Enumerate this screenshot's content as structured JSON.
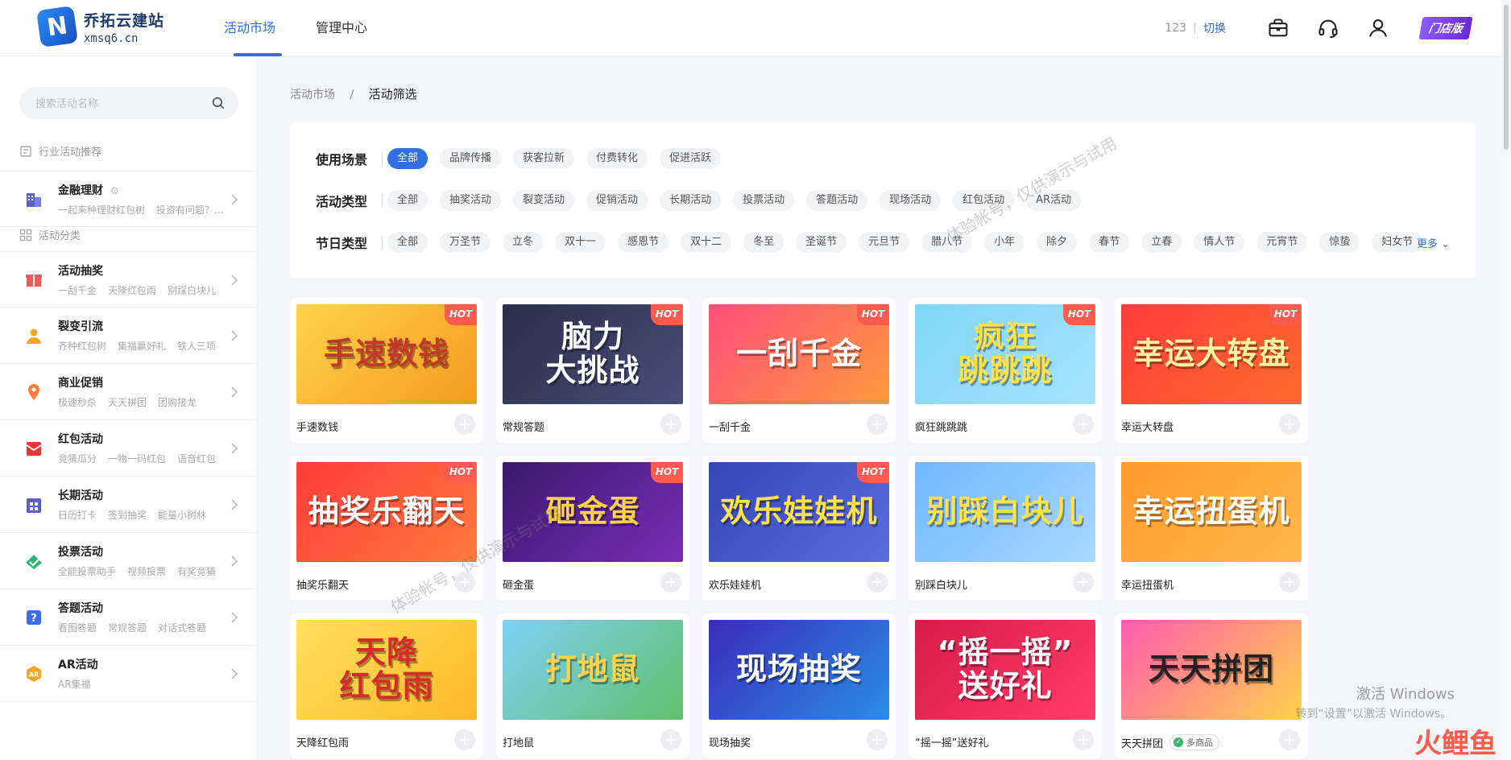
{
  "header": {
    "logo_glyph": "N",
    "site_name": "乔拓云建站",
    "site_domain": "xmsq6.cn",
    "nav": [
      {
        "label": "活动市场",
        "active": true
      },
      {
        "label": "管理中心",
        "active": false
      }
    ],
    "account_id": "123",
    "switch_label": "切换",
    "icons": [
      "briefcase-icon",
      "headset-icon",
      "user-icon"
    ],
    "store_badge": "门店版"
  },
  "sidebar": {
    "search_placeholder": "搜索活动名称",
    "industry_title": "行业活动推荐",
    "industry_items": [
      {
        "name": "金融理财",
        "sub": [
          "一起来种理财红包树",
          "投资有问题？..."
        ],
        "icon": "building-icon",
        "color": "#5b5fc7"
      }
    ],
    "category_title": "活动分类",
    "category_items": [
      {
        "name": "活动抽奖",
        "sub": [
          "一刮千金",
          "天降红包雨",
          "别踩白块儿"
        ],
        "icon": "gift-icon",
        "color": "#f05a5a"
      },
      {
        "name": "裂变引流",
        "sub": [
          "齐种红包树",
          "集福赢好礼",
          "铁人三项"
        ],
        "icon": "person-icon",
        "color": "#f5a623"
      },
      {
        "name": "商业促销",
        "sub": [
          "极速秒杀",
          "天天拼团",
          "团购接龙"
        ],
        "icon": "tag-icon",
        "color": "#ff7a3d"
      },
      {
        "name": "红包活动",
        "sub": [
          "竞猜瓜分",
          "一物一码红包",
          "语音红包"
        ],
        "icon": "envelope-icon",
        "color": "#e53935"
      },
      {
        "name": "长期活动",
        "sub": [
          "日历打卡",
          "签到抽奖",
          "能量小树林"
        ],
        "icon": "calendar-icon",
        "color": "#5b5fc7"
      },
      {
        "name": "投票活动",
        "sub": [
          "全能投票助手",
          "视频投票",
          "有奖竞猜"
        ],
        "icon": "check-icon",
        "color": "#2bb673"
      },
      {
        "name": "答题活动",
        "sub": [
          "看图答题",
          "常规答题",
          "对话式答题"
        ],
        "icon": "question-icon",
        "color": "#3a6ee8"
      },
      {
        "name": "AR活动",
        "sub": [
          "AR集福"
        ],
        "icon": "ar-icon",
        "color": "#f5a623"
      }
    ]
  },
  "breadcrumb": {
    "root": "活动市场",
    "sep": "/",
    "current": "活动筛选"
  },
  "filters": {
    "scene": {
      "label": "使用场景",
      "options": [
        "全部",
        "品牌传播",
        "获客拉新",
        "付费转化",
        "促进活跃"
      ],
      "active": 0
    },
    "type": {
      "label": "活动类型",
      "options": [
        "全部",
        "抽奖活动",
        "裂变活动",
        "促销活动",
        "长期活动",
        "投票活动",
        "答题活动",
        "现场活动",
        "红包活动",
        "AR活动"
      ],
      "active": -1
    },
    "festival": {
      "label": "节日类型",
      "options": [
        "全部",
        "万圣节",
        "立冬",
        "双十一",
        "感恩节",
        "双十二",
        "冬至",
        "圣诞节",
        "元旦节",
        "腊八节",
        "小年",
        "除夕",
        "春节",
        "立春",
        "情人节",
        "元宵节",
        "惊蛰",
        "妇女节"
      ],
      "active": -1
    },
    "more_label": "更多"
  },
  "cards": [
    {
      "title": "手速数钱",
      "art": "手速数钱",
      "hot": true,
      "bg": "linear-gradient(135deg,#ffd24a,#f59a1e)",
      "fg": "#c0392b"
    },
    {
      "title": "常规答题",
      "art": "脑力\n大挑战",
      "hot": true,
      "bg": "linear-gradient(135deg,#2b2d4a,#4a4e7a)",
      "fg": "#ffffff"
    },
    {
      "title": "一刮千金",
      "art": "一刮千金",
      "hot": true,
      "bg": "linear-gradient(135deg,#ff4d7a,#ff9a3c)",
      "fg": "#ffffff"
    },
    {
      "title": "疯狂跳跳跳",
      "art": "疯狂\n跳跳跳",
      "hot": true,
      "bg": "linear-gradient(135deg,#7fd6f5,#a6e3ff)",
      "fg": "#ffe14a"
    },
    {
      "title": "幸运大转盘",
      "art": "幸运大转盘",
      "hot": true,
      "bg": "linear-gradient(135deg,#ff3d3d,#ff6a2a)",
      "fg": "#fff3a0"
    },
    {
      "title": "抽奖乐翻天",
      "art": "抽奖乐翻天",
      "hot": true,
      "bg": "linear-gradient(135deg,#ff3b3b,#ff7a3c)",
      "fg": "#ffffff"
    },
    {
      "title": "砸金蛋",
      "art": "砸金蛋",
      "hot": true,
      "bg": "linear-gradient(135deg,#3a1a6e,#7a2cb8)",
      "fg": "#ffd24a"
    },
    {
      "title": "欢乐娃娃机",
      "art": "欢乐娃娃机",
      "hot": true,
      "bg": "linear-gradient(135deg,#3346b8,#5b6ee0)",
      "fg": "#ffe14a"
    },
    {
      "title": "别踩白块儿",
      "art": "别踩白块儿",
      "hot": false,
      "bg": "linear-gradient(135deg,#6fb8ff,#a8d8ff)",
      "fg": "#ffe14a"
    },
    {
      "title": "幸运扭蛋机",
      "art": "幸运扭蛋机",
      "hot": false,
      "bg": "linear-gradient(135deg,#ff9a2a,#ffb84a)",
      "fg": "#ffffff"
    },
    {
      "title": "天降红包雨",
      "art": "天降\n红包雨",
      "hot": false,
      "bg": "linear-gradient(135deg,#ffe05a,#ffb82a)",
      "fg": "#d62b2b"
    },
    {
      "title": "打地鼠",
      "art": "打地鼠",
      "hot": false,
      "bg": "linear-gradient(135deg,#7fd0f5,#5fc06a)",
      "fg": "#ffd24a"
    },
    {
      "title": "现场抽奖",
      "art": "现场抽奖",
      "hot": false,
      "bg": "linear-gradient(135deg,#3b2bb8,#2a8ee8)",
      "fg": "#ffffff"
    },
    {
      "title": "“摇一摇”送好礼",
      "art": "“摇一摇”\n送好礼",
      "hot": false,
      "bg": "linear-gradient(135deg,#d81b4a,#ff3d6a)",
      "fg": "#ffffff"
    },
    {
      "title": "天天拼团",
      "art": "天天拼团",
      "hot": false,
      "bg": "linear-gradient(135deg,#ff5ab0,#ffd24a)",
      "fg": "#222222",
      "tag": "多商品"
    }
  ],
  "watermarks": [
    "体验帐号，仅供演示与试用",
    "体验帐号，仅供演示与试用"
  ],
  "windows_activation": {
    "line1": "激活 Windows",
    "line2": "转到“设置”以激活 Windows。"
  },
  "corner_logo": "火鲤鱼"
}
